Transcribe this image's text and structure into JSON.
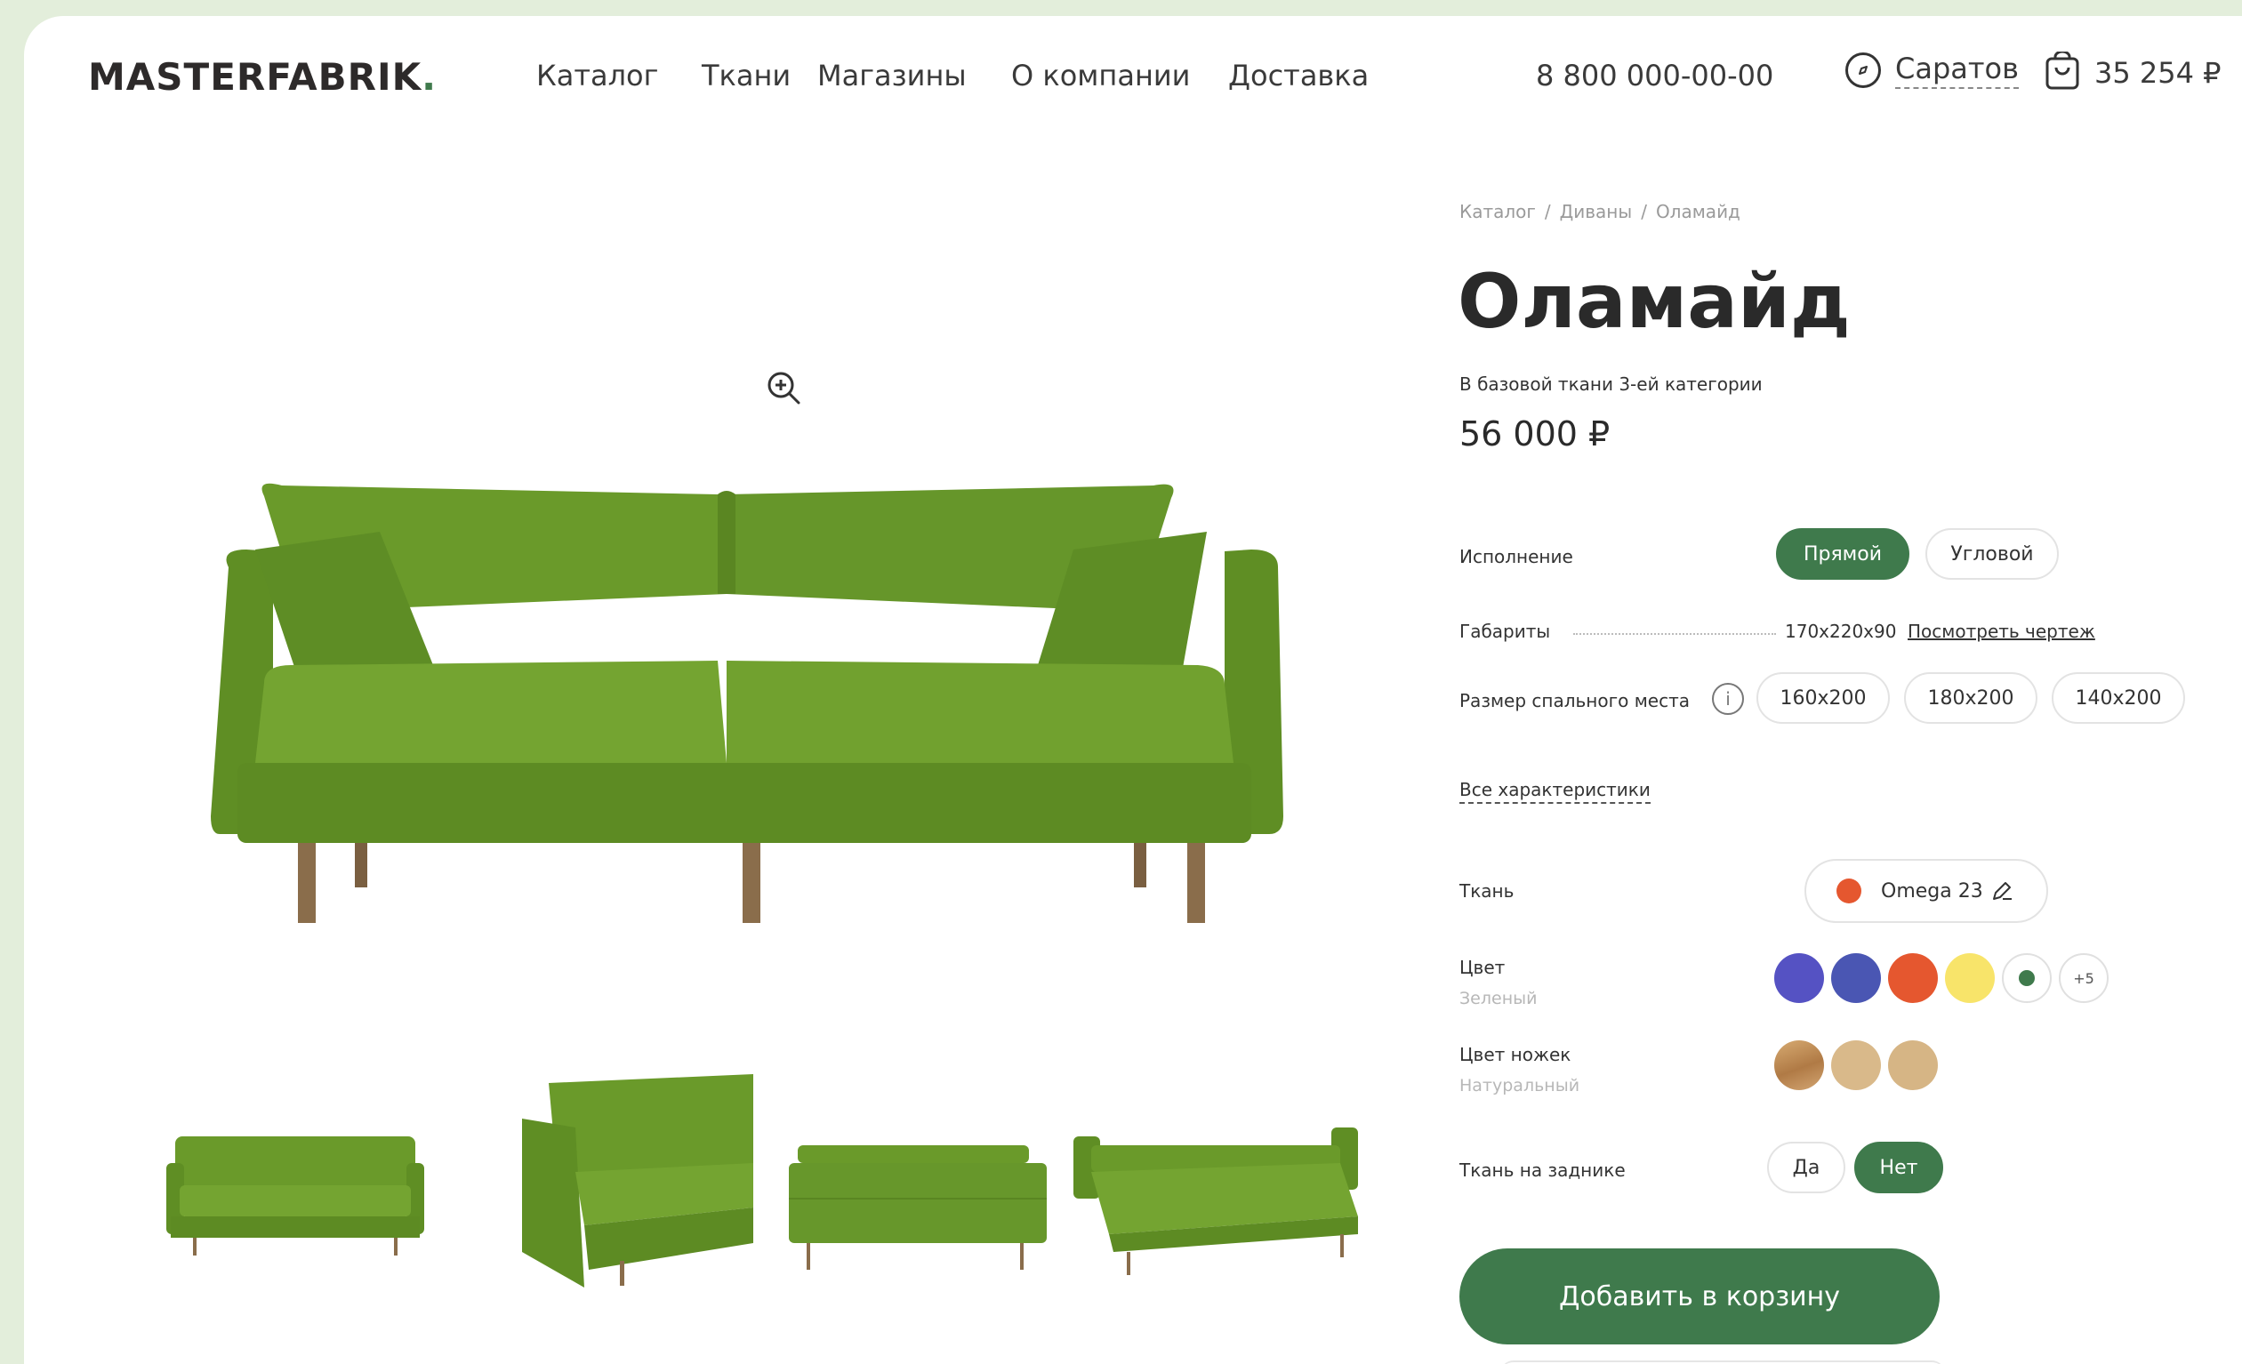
{
  "header": {
    "logo_main": "MASTERFABRIK",
    "logo_dot": ".",
    "nav": [
      "Каталог",
      "Ткани",
      "Магазины",
      "О компании",
      "Доставка"
    ],
    "phone": "8 800 000-00-00",
    "city": "Саратов",
    "cart_total": "35 254 ₽"
  },
  "breadcrumb": [
    "Каталог",
    "/",
    "Диваны",
    "/",
    "Оламайд"
  ],
  "product": {
    "title": "Оламайд",
    "subtitle": "В базовой ткани 3-ей категории",
    "price": "56 000 ₽"
  },
  "options": {
    "execution": {
      "label": "Исполнение",
      "choices": [
        "Прямой",
        "Угловой"
      ],
      "selected": "Прямой"
    },
    "dimensions": {
      "label": "Габариты",
      "value": "170x220x90",
      "link": "Посмотреть чертеж"
    },
    "sleep_size": {
      "label": "Размер спального места",
      "info": "i",
      "choices": [
        "160x200",
        "180x200",
        "140x200"
      ]
    },
    "all_specs": "Все характеристики",
    "fabric": {
      "label": "Ткань",
      "value": "Omega 23"
    },
    "color": {
      "label": "Цвет",
      "selected_name": "Зеленый",
      "swatches": [
        "#5552c3",
        "#4a56b3",
        "#e5572f",
        "#f8e46a"
      ],
      "selected": "#3f7a4c",
      "more": "+5"
    },
    "legs_color": {
      "label": "Цвет ножек",
      "selected_name": "Натуральный",
      "swatches": [
        "#c79a63",
        "#d9b98a",
        "#d8b788"
      ]
    },
    "back_fabric": {
      "label": "Ткань на заднике",
      "choices": [
        "Да",
        "Нет"
      ],
      "selected": "Нет"
    }
  },
  "cta": "Добавить в корзину",
  "colors": {
    "accent": "#3f7a4c",
    "sofa": "#6c9a2c",
    "background": "#e3eedb"
  }
}
